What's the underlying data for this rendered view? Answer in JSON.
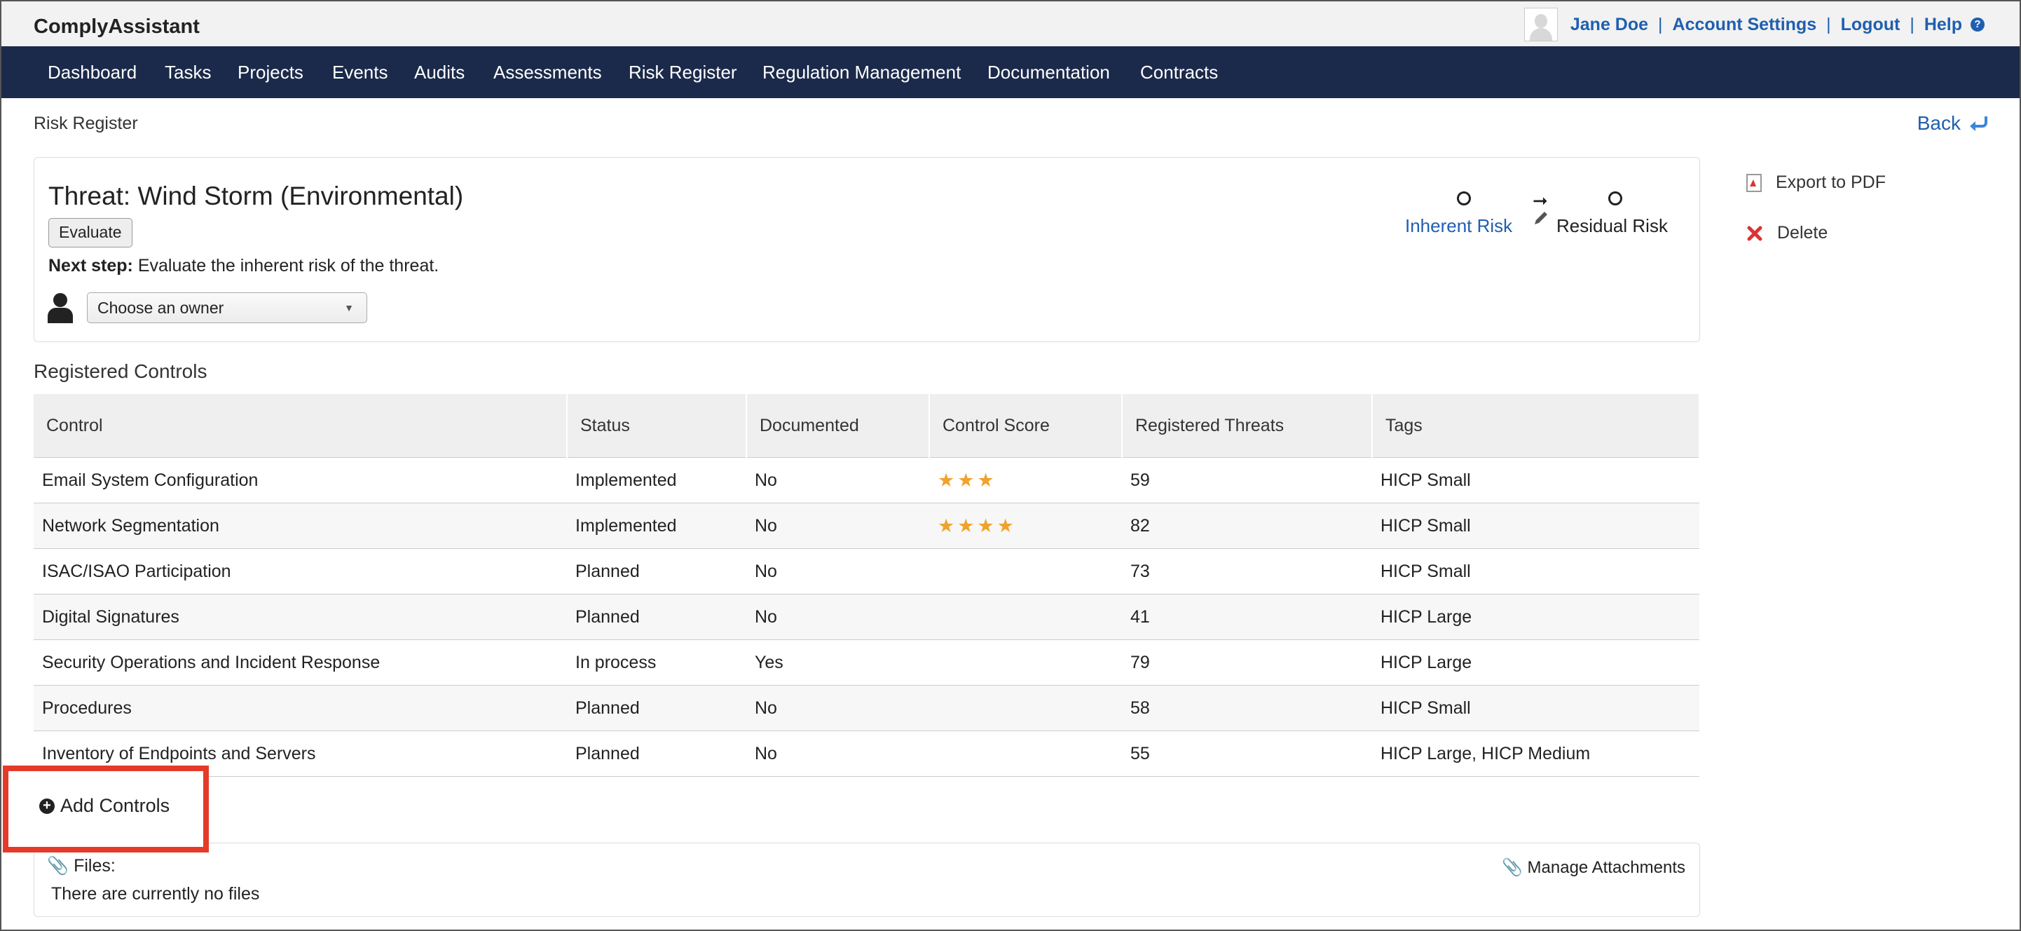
{
  "app": {
    "brand": "ComplyAssistant"
  },
  "userbar": {
    "user_name": "Jane Doe",
    "account_settings": "Account Settings",
    "logout": "Logout",
    "help": "Help",
    "separator": "|"
  },
  "nav": {
    "items": [
      {
        "label": "Dashboard"
      },
      {
        "label": "Tasks"
      },
      {
        "label": "Projects"
      },
      {
        "label": "Events"
      },
      {
        "label": "Audits"
      },
      {
        "label": "Assessments"
      },
      {
        "label": "Risk Register"
      },
      {
        "label": "Regulation Management"
      },
      {
        "label": "Documentation"
      },
      {
        "label": "Contracts"
      }
    ]
  },
  "breadcrumb": "Risk Register",
  "back_label": "Back",
  "threat": {
    "title": "Threat: Wind Storm (Environmental)",
    "evaluate_label": "Evaluate",
    "next_step_label": "Next step:",
    "next_step_text": " Evaluate the inherent risk of the threat.",
    "owner_select": "Choose an owner",
    "inherent_risk": "Inherent Risk",
    "residual_risk": "Residual Risk"
  },
  "actions": {
    "export_pdf": "Export to PDF",
    "delete": "Delete"
  },
  "controls": {
    "section_title": "Registered Controls",
    "headers": [
      "Control",
      "Status",
      "Documented",
      "Control Score",
      "Registered Threats",
      "Tags"
    ],
    "rows": [
      {
        "control": "Email System Configuration",
        "status": "Implemented",
        "documented": "No",
        "score": 3,
        "threats": "59",
        "tags": "HICP Small"
      },
      {
        "control": "Network Segmentation",
        "status": "Implemented",
        "documented": "No",
        "score": 4,
        "threats": "82",
        "tags": "HICP Small"
      },
      {
        "control": "ISAC/ISAO Participation",
        "status": "Planned",
        "documented": "No",
        "score": 0,
        "threats": "73",
        "tags": "HICP Small"
      },
      {
        "control": "Digital Signatures",
        "status": "Planned",
        "documented": "No",
        "score": 0,
        "threats": "41",
        "tags": "HICP Large"
      },
      {
        "control": "Security Operations and Incident Response",
        "status": "In process",
        "documented": "Yes",
        "score": 0,
        "threats": "79",
        "tags": "HICP Large"
      },
      {
        "control": "Procedures",
        "status": "Planned",
        "documented": "No",
        "score": 0,
        "threats": "58",
        "tags": "HICP Small"
      },
      {
        "control": "Inventory of Endpoints and Servers",
        "status": "Planned",
        "documented": "No",
        "score": 0,
        "threats": "55",
        "tags": "HICP Large, HICP Medium"
      }
    ],
    "add_label": "Add Controls"
  },
  "files": {
    "label": "Files:",
    "empty_text": "There are currently no files",
    "manage_label": "Manage Attachments"
  },
  "colors": {
    "nav_bg": "#1b2a4a",
    "link": "#1f5fb0",
    "star": "#f0a22c",
    "highlight": "#e53a2a"
  },
  "icons": [
    "avatar-icon",
    "help-icon",
    "back-arrow-icon",
    "person-icon",
    "pencil-icon",
    "pdf-icon",
    "delete-x-icon",
    "star-icon",
    "plus-circle-icon",
    "paperclip-icon"
  ]
}
